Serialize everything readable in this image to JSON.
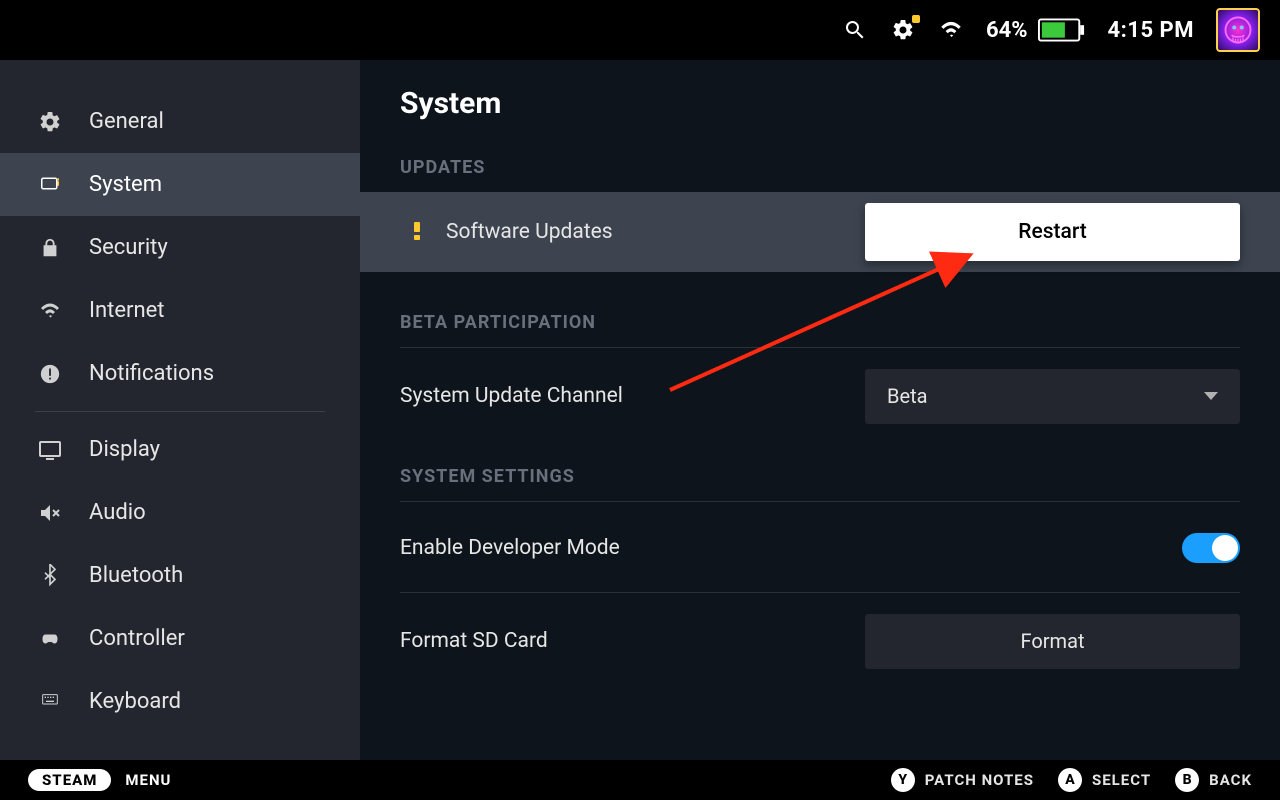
{
  "topbar": {
    "battery_pct": "64%",
    "clock": "4:15 PM"
  },
  "sidebar": {
    "items": [
      {
        "label": "General"
      },
      {
        "label": "System"
      },
      {
        "label": "Security"
      },
      {
        "label": "Internet"
      },
      {
        "label": "Notifications"
      },
      {
        "label": "Display"
      },
      {
        "label": "Audio"
      },
      {
        "label": "Bluetooth"
      },
      {
        "label": "Controller"
      },
      {
        "label": "Keyboard"
      }
    ]
  },
  "main": {
    "title": "System",
    "sections": {
      "updates": {
        "head": "UPDATES",
        "row_label": "Software Updates",
        "button": "Restart"
      },
      "beta": {
        "head": "BETA PARTICIPATION",
        "row_label": "System Update Channel",
        "selected": "Beta"
      },
      "settings": {
        "head": "SYSTEM SETTINGS",
        "dev_label": "Enable Developer Mode",
        "format_label": "Format SD Card",
        "format_button": "Format"
      }
    }
  },
  "bottombar": {
    "pill": "STEAM",
    "menu": "MENU",
    "hints": [
      {
        "key": "Y",
        "label": "PATCH NOTES"
      },
      {
        "key": "A",
        "label": "SELECT"
      },
      {
        "key": "B",
        "label": "BACK"
      }
    ]
  }
}
